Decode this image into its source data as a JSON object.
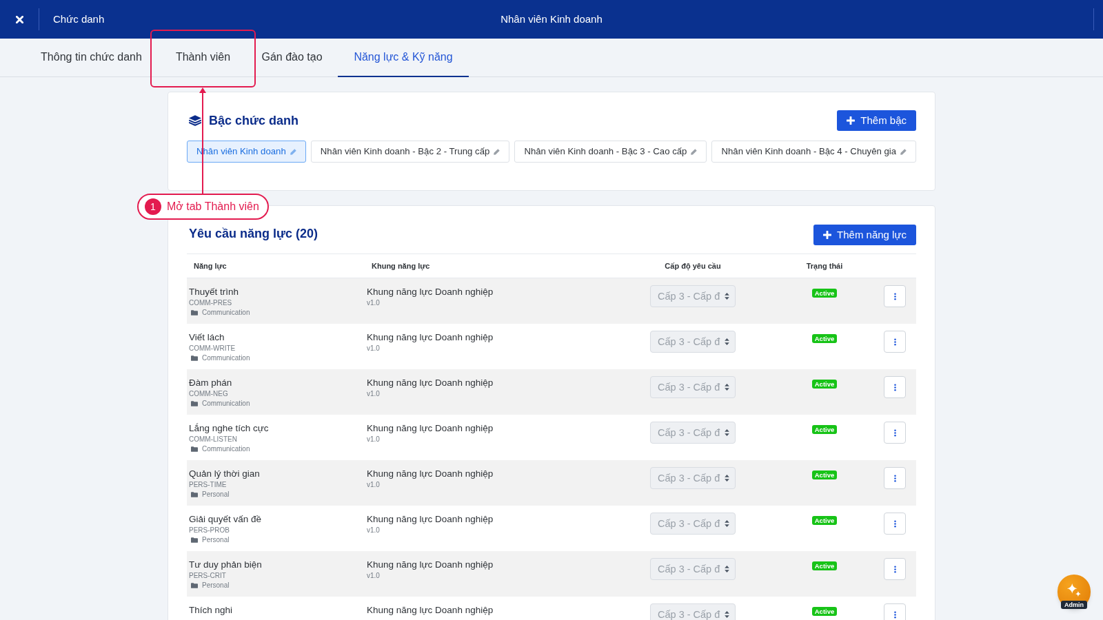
{
  "header": {
    "section": "Chức danh",
    "title": "Nhân viên Kinh doanh"
  },
  "tabs": [
    {
      "label": "Thông tin chức danh",
      "selected": false
    },
    {
      "label": "Thành viên",
      "selected": false
    },
    {
      "label": "Gán đào tạo",
      "selected": false
    },
    {
      "label": "Năng lực & Kỹ năng",
      "selected": true
    }
  ],
  "levels_card": {
    "title": "Bậc chức danh",
    "add_button": "Thêm bậc",
    "levels": [
      {
        "label": "Nhân viên Kinh doanh",
        "selected": true
      },
      {
        "label": "Nhân viên Kinh doanh - Bậc 2 - Trung cấp",
        "selected": false
      },
      {
        "label": "Nhân viên Kinh doanh - Bậc 3 - Cao cấp",
        "selected": false
      },
      {
        "label": "Nhân viên Kinh doanh - Bậc 4 - Chuyên gia",
        "selected": false
      }
    ]
  },
  "requirements_card": {
    "title": "Yêu cầu năng lực (20)",
    "add_button": "Thêm năng lực",
    "columns": [
      "Năng lực",
      "Khung năng lực",
      "Cấp độ yêu cầu",
      "Trạng thái"
    ],
    "rows": [
      {
        "name": "Thuyết trình",
        "code": "COMM-PRES",
        "category": "Communication",
        "framework": "Khung năng lực Doanh nghiệp",
        "version": "v1.0",
        "required_level": "Cấp 3 - Cấp đ",
        "status": "Active"
      },
      {
        "name": "Viết lách",
        "code": "COMM-WRITE",
        "category": "Communication",
        "framework": "Khung năng lực Doanh nghiệp",
        "version": "v1.0",
        "required_level": "Cấp 3 - Cấp đ",
        "status": "Active"
      },
      {
        "name": "Đàm phán",
        "code": "COMM-NEG",
        "category": "Communication",
        "framework": "Khung năng lực Doanh nghiệp",
        "version": "v1.0",
        "required_level": "Cấp 3 - Cấp đ",
        "status": "Active"
      },
      {
        "name": "Lắng nghe tích cực",
        "code": "COMM-LISTEN",
        "category": "Communication",
        "framework": "Khung năng lực Doanh nghiệp",
        "version": "v1.0",
        "required_level": "Cấp 3 - Cấp đ",
        "status": "Active"
      },
      {
        "name": "Quản lý thời gian",
        "code": "PERS-TIME",
        "category": "Personal",
        "framework": "Khung năng lực Doanh nghiệp",
        "version": "v1.0",
        "required_level": "Cấp 3 - Cấp đ",
        "status": "Active"
      },
      {
        "name": "Giải quyết vấn đề",
        "code": "PERS-PROB",
        "category": "Personal",
        "framework": "Khung năng lực Doanh nghiệp",
        "version": "v1.0",
        "required_level": "Cấp 3 - Cấp đ",
        "status": "Active"
      },
      {
        "name": "Tư duy phản biện",
        "code": "PERS-CRIT",
        "category": "Personal",
        "framework": "Khung năng lực Doanh nghiệp",
        "version": "v1.0",
        "required_level": "Cấp 3 - Cấp đ",
        "status": "Active"
      },
      {
        "name": "Thích nghi",
        "framework": "Khung năng lực Doanh nghiệp",
        "required_level": "Cấp 3 - Cấp đ",
        "status": "Active"
      }
    ]
  },
  "annotation": {
    "step": "1",
    "text": "Mở tab Thành viên"
  },
  "assistant_button": {
    "role": "Admin"
  }
}
